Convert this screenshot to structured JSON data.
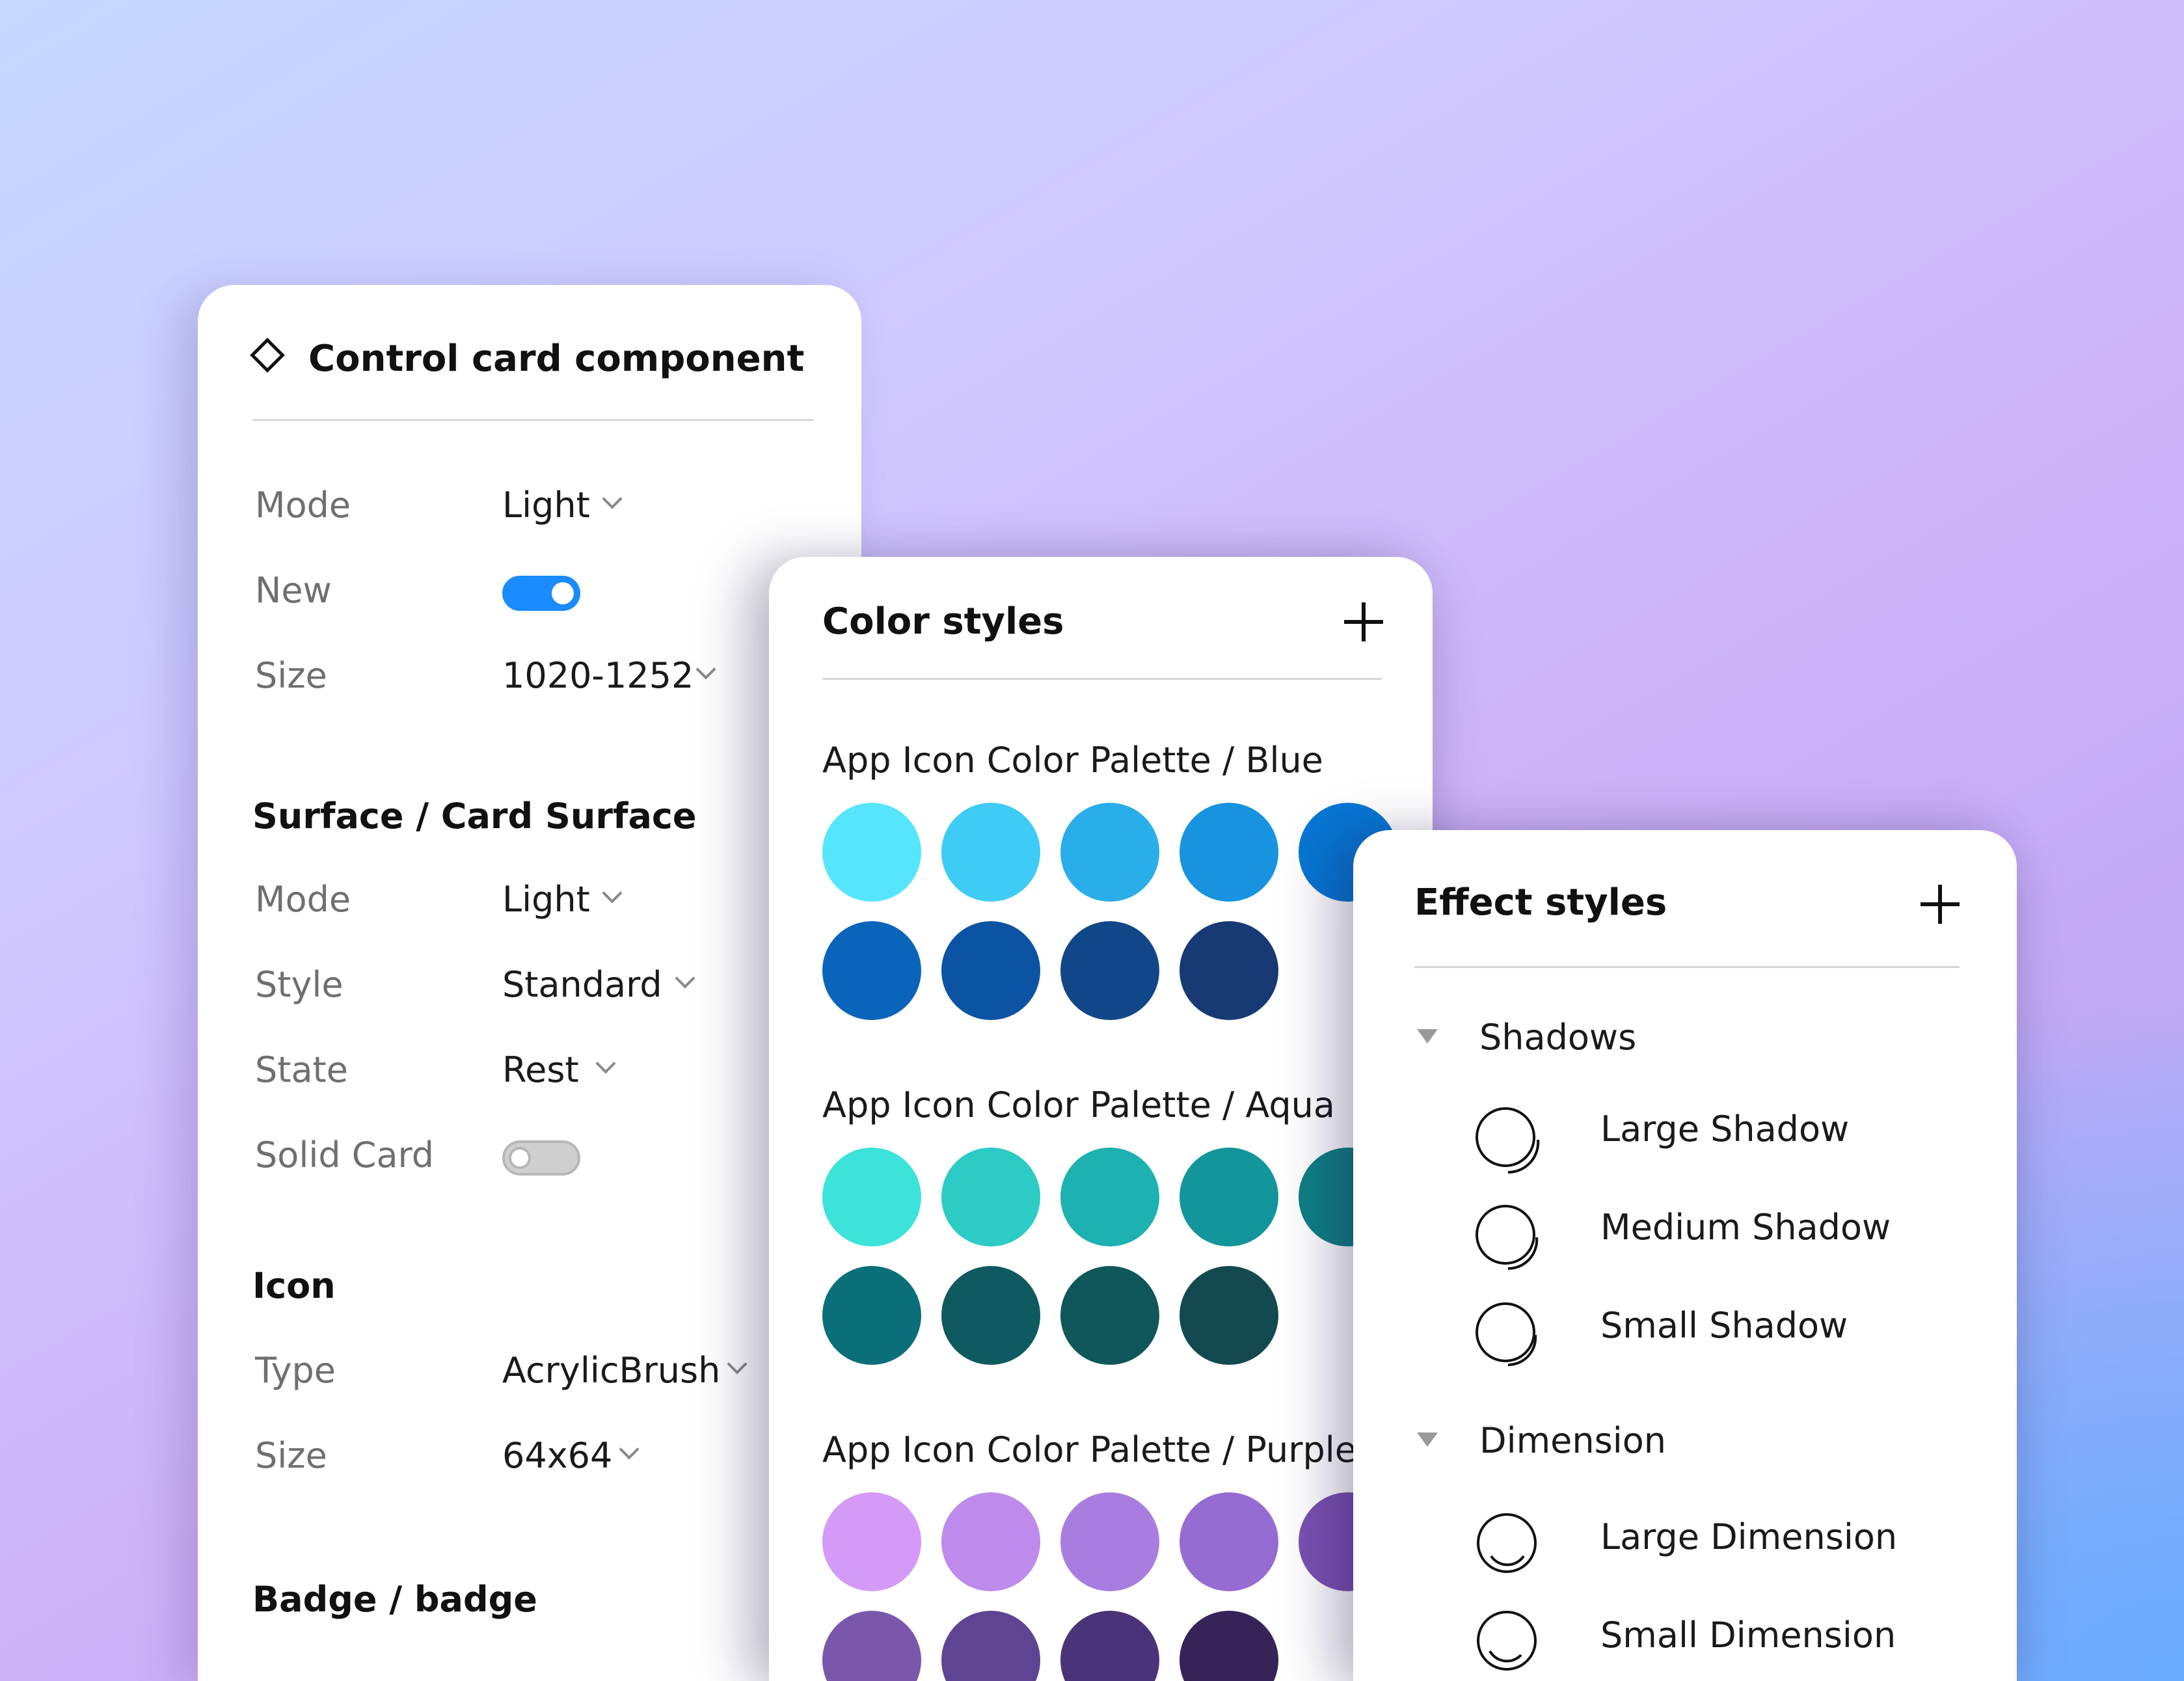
{
  "control_card": {
    "title": "Control card component",
    "icon": "component-diamond-icon",
    "rows_top": [
      {
        "label": "Mode",
        "value": "Light",
        "type": "dropdown"
      },
      {
        "label": "New",
        "value": "on",
        "type": "toggle"
      },
      {
        "label": "Size",
        "value": "1020-1252",
        "type": "dropdown"
      }
    ],
    "surface": {
      "title": "Surface / Card Surface",
      "rows": [
        {
          "label": "Mode",
          "value": "Light",
          "type": "dropdown"
        },
        {
          "label": "Style",
          "value": "Standard",
          "type": "dropdown"
        },
        {
          "label": "State",
          "value": "Rest",
          "type": "dropdown"
        },
        {
          "label": "Solid Card",
          "value": "off",
          "type": "toggle"
        }
      ]
    },
    "icon_section": {
      "title": "Icon",
      "rows": [
        {
          "label": "Type",
          "value": "AcrylicBrush",
          "type": "dropdown"
        },
        {
          "label": "Size",
          "value": "64x64",
          "type": "dropdown"
        }
      ]
    },
    "badge": {
      "title": "Badge / badge"
    }
  },
  "color_styles": {
    "title": "Color styles",
    "add_icon": "plus-icon",
    "palettes": [
      {
        "name": "App Icon Color Palette / Blue",
        "colors": [
          "#55e6fd",
          "#3ecbf5",
          "#2aaeea",
          "#1793e0",
          "#0777d4",
          "#0b64bb",
          "#0c54a3",
          "#114688",
          "#173a75"
        ]
      },
      {
        "name": "App Icon Color Palette / Aqua",
        "colors": [
          "#3ce3da",
          "#2ccbc6",
          "#1db1b1",
          "#13969b",
          "#0e8185",
          "#0a6f79",
          "#0f5a60",
          "#0f575b",
          "#134a51"
        ]
      },
      {
        "name": "App Icon Color Palette / Purple",
        "colors": [
          "#d39af7",
          "#be8aec",
          "#a97de0",
          "#966cd3",
          "#7b52b3",
          "#7a57ab",
          "#5e4493",
          "#4a3479",
          "#362458"
        ]
      }
    ]
  },
  "effect_styles": {
    "title": "Effect styles",
    "add_icon": "plus-icon",
    "groups": [
      {
        "name": "Shadows",
        "items": [
          "Large Shadow",
          "Medium Shadow",
          "Small Shadow"
        ]
      },
      {
        "name": "Dimension",
        "items": [
          "Large Dimension",
          "Small Dimension"
        ]
      }
    ]
  }
}
